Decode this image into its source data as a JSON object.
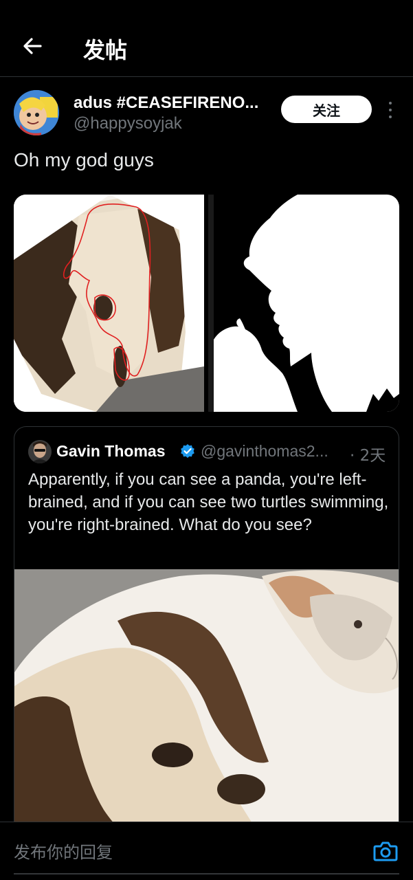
{
  "header": {
    "title": "发帖"
  },
  "tweet": {
    "author_name": "adus #CEASEFIRENO...",
    "author_handle": "@happysoyjak",
    "follow_label": "关注",
    "text": "Oh my god guys"
  },
  "quote": {
    "name": "Gavin Thomas",
    "handle": "@gavinthomas2...",
    "time": "· 2天",
    "text": "Apparently, if you can see a panda, you're left-brained, and if you can see two turtles swimming, you're right-brained. What do you see?"
  },
  "reply": {
    "placeholder": "发布你的回复"
  },
  "colors": {
    "background": "#000000",
    "accent": "#1d9bf0",
    "muted": "#71767b",
    "text": "#e7e9ea"
  }
}
